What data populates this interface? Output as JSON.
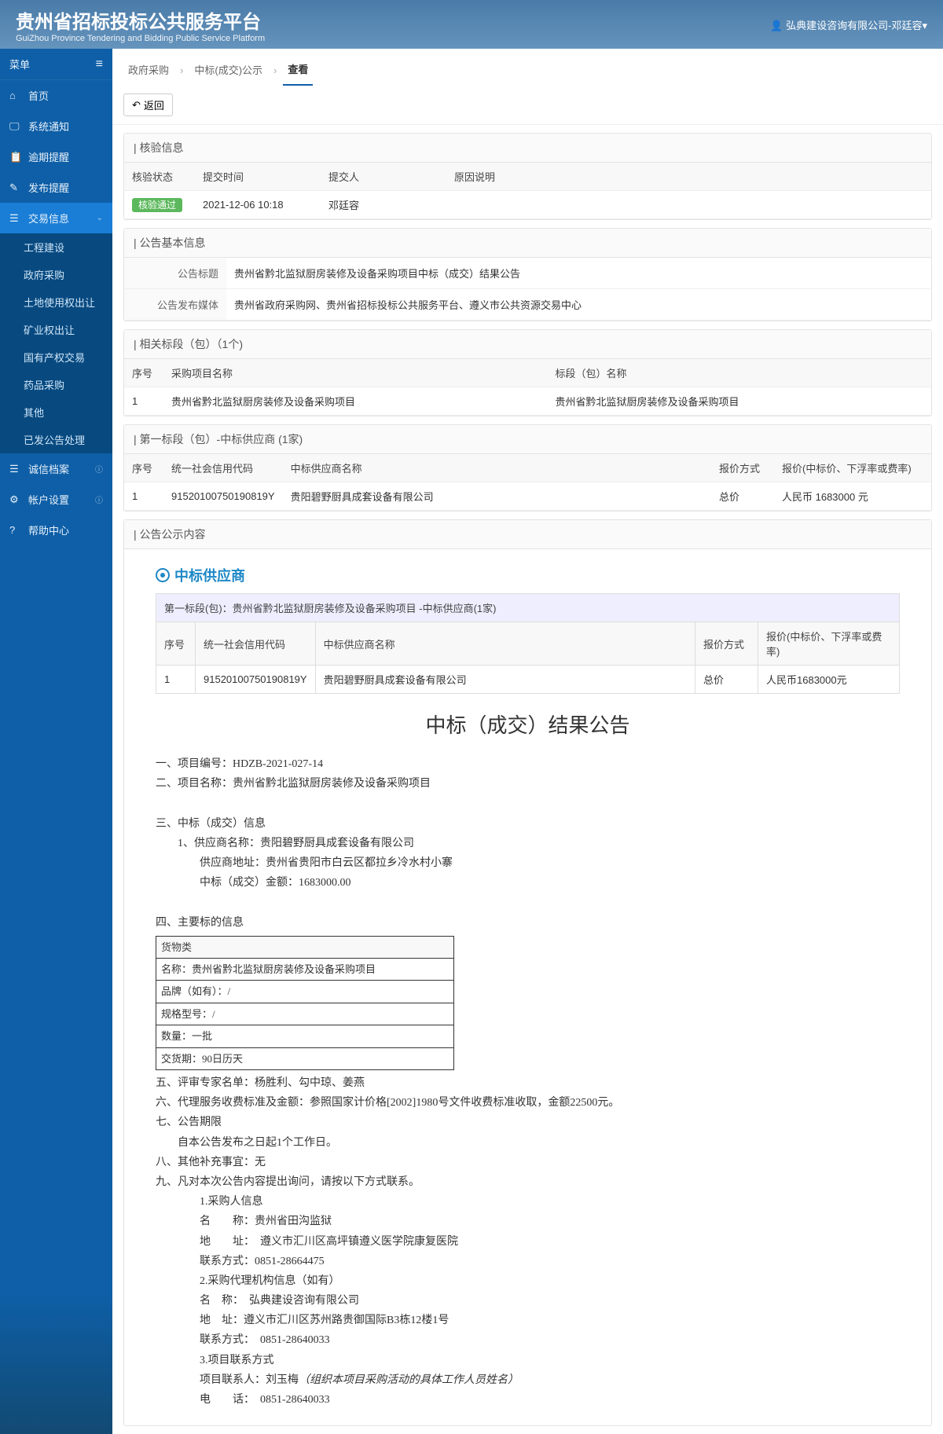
{
  "header": {
    "title": "贵州省招标投标公共服务平台",
    "subtitle": "GuiZhou Province Tendering and Bidding Public Service Platform",
    "user_prefix": "👤",
    "user": "弘典建设咨询有限公司-邓廷容"
  },
  "sidebar": {
    "menu_label": "菜单",
    "items": [
      {
        "icon": "⌂",
        "label": "首页"
      },
      {
        "icon": "🖵",
        "label": "系统通知"
      },
      {
        "icon": "📋",
        "label": "逾期提醒"
      },
      {
        "icon": "✎",
        "label": "发布提醒"
      },
      {
        "icon": "☰",
        "label": "交易信息",
        "active": true,
        "expandable": true
      }
    ],
    "submenu": [
      "工程建设",
      "政府采购",
      "土地使用权出让",
      "矿业权出让",
      "国有产权交易",
      "药品采购",
      "其他",
      "已发公告处理"
    ],
    "items_after": [
      {
        "icon": "☰",
        "label": "诚信档案",
        "info": true
      },
      {
        "icon": "⚙",
        "label": "帐户设置",
        "info": true
      },
      {
        "icon": "?",
        "label": "帮助中心"
      }
    ]
  },
  "breadcrumb": [
    "政府采购",
    "中标(成交)公示",
    "查看"
  ],
  "back_button": "返回",
  "panels": {
    "verify": {
      "title": "核验信息",
      "headers": [
        "核验状态",
        "提交时间",
        "提交人",
        "原因说明"
      ],
      "row": {
        "status": "核验通过",
        "time": "2021-12-06 10:18",
        "person": "邓廷容",
        "reason": ""
      }
    },
    "basic": {
      "title": "公告基本信息",
      "rows": [
        {
          "label": "公告标题",
          "value": "贵州省黔北监狱厨房装修及设备采购项目中标（成交）结果公告"
        },
        {
          "label": "公告发布媒体",
          "value": "贵州省政府采购网、贵州省招标投标公共服务平台、遵义市公共资源交易中心"
        }
      ]
    },
    "related": {
      "title": "相关标段（包）（1个)",
      "headers": [
        "序号",
        "采购项目名称",
        "标段（包）名称"
      ],
      "row": {
        "no": "1",
        "proj": "贵州省黔北监狱厨房装修及设备采购项目",
        "pkg": "贵州省黔北监狱厨房装修及设备采购项目"
      }
    },
    "supplier": {
      "title": "第一标段（包）-中标供应商 (1家)",
      "headers": [
        "序号",
        "统一社会信用代码",
        "中标供应商名称",
        "报价方式",
        "报价(中标价、下浮率或费率)"
      ],
      "row": {
        "no": "1",
        "code": "91520100750190819Y",
        "name": "贵阳碧野厨具成套设备有限公司",
        "method": "总价",
        "price": "人民币 1683000 元"
      }
    },
    "content": {
      "title": "公告公示内容",
      "winning_label": "中标供应商",
      "inner_title": "第一标段(包)：贵州省黔北监狱厨房装修及设备采购项目 -中标供应商(1家)",
      "inner_headers": [
        "序号",
        "统一社会信用代码",
        "中标供应商名称",
        "报价方式",
        "报价(中标价、下浮率或费率)"
      ],
      "inner_row": {
        "no": "1",
        "code": "91520100750190819Y",
        "name": "贵阳碧野厨具成套设备有限公司",
        "method": "总价",
        "price": "人民币1683000元"
      }
    }
  },
  "notice": {
    "title": "中标（成交）结果公告",
    "l1": "一、项目编号：HDZB-2021-027-14",
    "l2": "二、项目名称：贵州省黔北监狱厨房装修及设备采购项目",
    "l3": "三、中标（成交）信息",
    "l3_1": "1、供应商名称：贵阳碧野厨具成套设备有限公司",
    "l3_1a": "供应商地址：贵州省贵阳市白云区都拉乡冷水村小寨",
    "l3_1b": "中标（成交）金额：1683000.00",
    "l4": "四、主要标的信息",
    "goods": {
      "header": "货物类",
      "r1": "名称：贵州省黔北监狱厨房装修及设备采购项目",
      "r2": "品牌（如有）：/",
      "r3": "规格型号：/",
      "r4": "数量：一批",
      "r5": "交货期：90日历天"
    },
    "l5": "五、评审专家名单：杨胜利、勾中琼、姜燕",
    "l6": "六、代理服务收费标准及金额：参照国家计价格[2002]1980号文件收费标准收取，金额22500元。",
    "l7": "七、公告期限",
    "l7_1": "自本公告发布之日起1个工作日。",
    "l8": "八、其他补充事宜：无",
    "l9": "九、凡对本次公告内容提出询问，请按以下方式联系。",
    "l9_1": "1.采购人信息",
    "l9_1a": "名　　称：贵州省田沟监狱",
    "l9_1b": "地　　址：　遵义市汇川区高坪镇遵义医学院康复医院",
    "l9_1c": "联系方式：0851-28664475",
    "l9_2": "2.采购代理机构信息（如有）",
    "l9_2a": "名　称：　弘典建设咨询有限公司",
    "l9_2b": "地　址：遵义市汇川区苏州路贵御国际B3栋12楼1号",
    "l9_2c": "联系方式：　0851-28640033",
    "l9_3": "3.项目联系方式",
    "l9_3a_pre": "项目联系人：刘玉梅",
    "l9_3a_italic": "（组织本项目采购活动的具体工作人员姓名）",
    "l9_3b": "电　　话：　0851-28640033"
  }
}
